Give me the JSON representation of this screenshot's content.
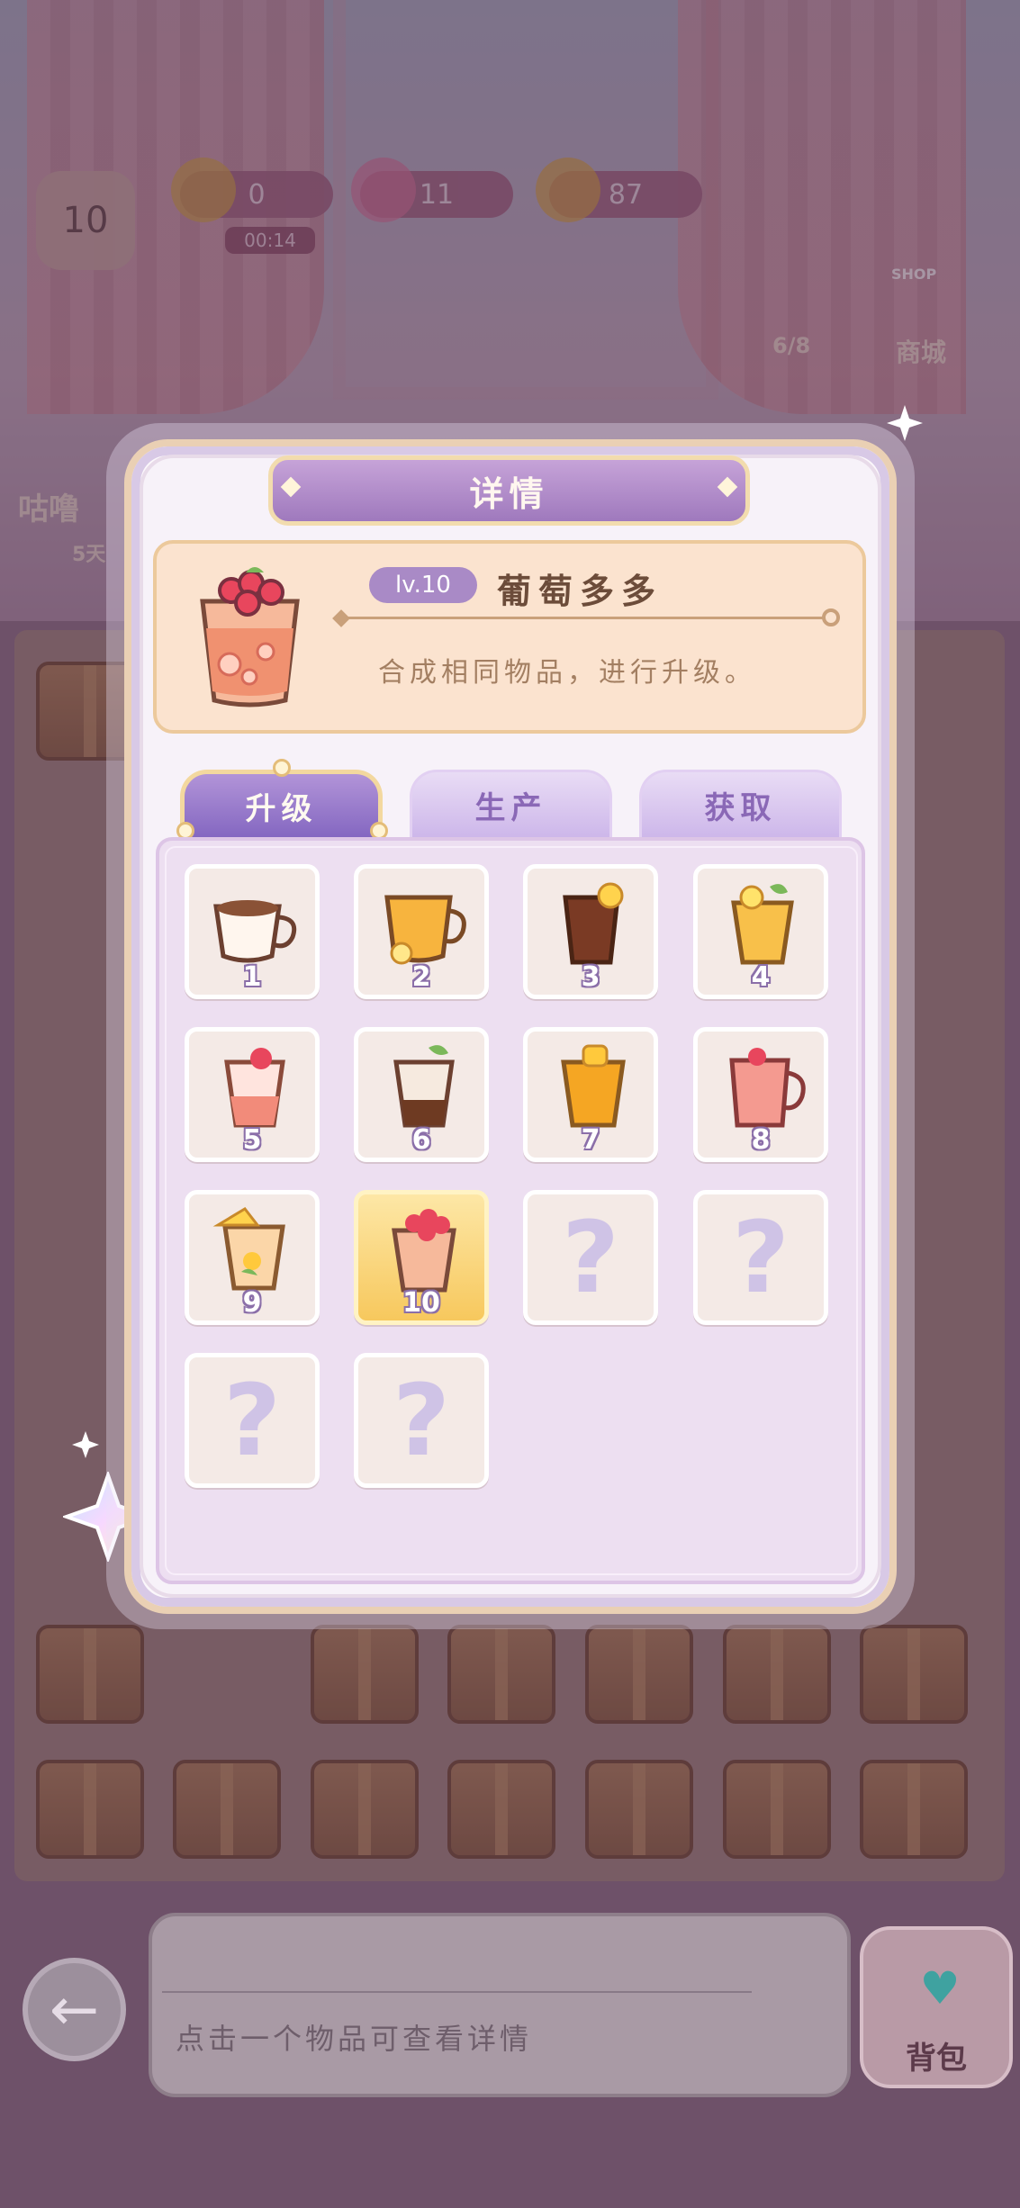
{
  "hud": {
    "level": "10",
    "energy": "0",
    "energy_timer": "00:14",
    "gems": "11",
    "coins": "87"
  },
  "background": {
    "left_name": "咕噜",
    "left_sub": "5天",
    "shop_label": "商城",
    "shop_badge": "SHOP",
    "progress": "6/8"
  },
  "modal": {
    "title": "详情",
    "item": {
      "level_badge": "lv.10",
      "name": "葡萄多多",
      "description": "合成相同物品，进行升级。"
    },
    "tabs": [
      {
        "label": "升级",
        "active": true
      },
      {
        "label": "生产",
        "active": false
      },
      {
        "label": "获取",
        "active": false
      }
    ],
    "chain": [
      {
        "num": "1",
        "icon": "coffee-cup-icon",
        "known": true
      },
      {
        "num": "2",
        "icon": "flower-tea-icon",
        "known": true
      },
      {
        "num": "3",
        "icon": "cola-glass-icon",
        "known": true
      },
      {
        "num": "4",
        "icon": "lemonade-icon",
        "known": true
      },
      {
        "num": "5",
        "icon": "strawberry-parfait-icon",
        "known": true
      },
      {
        "num": "6",
        "icon": "chocolate-drink-icon",
        "known": true
      },
      {
        "num": "7",
        "icon": "mango-drink-icon",
        "known": true
      },
      {
        "num": "8",
        "icon": "strawberry-jug-icon",
        "known": true
      },
      {
        "num": "9",
        "icon": "fruit-punch-icon",
        "known": true
      },
      {
        "num": "10",
        "icon": "grape-drink-icon",
        "known": true,
        "selected": true
      },
      {
        "num": "",
        "icon": "question-mark-icon",
        "known": false,
        "symbol": "?"
      },
      {
        "num": "",
        "icon": "question-mark-icon",
        "known": false,
        "symbol": "?"
      },
      {
        "num": "",
        "icon": "question-mark-icon",
        "known": false,
        "symbol": "?"
      },
      {
        "num": "",
        "icon": "question-mark-icon",
        "known": false,
        "symbol": "?"
      }
    ]
  },
  "bottom": {
    "hint": "点击一个物品可查看详情",
    "bag_label": "背包",
    "back_icon": "←"
  },
  "colors": {
    "accent_purple": "#9f79bd",
    "gold_border": "#f2dcae",
    "card_peach": "#fbe3cf",
    "selected_slot": "#f7c85d"
  }
}
